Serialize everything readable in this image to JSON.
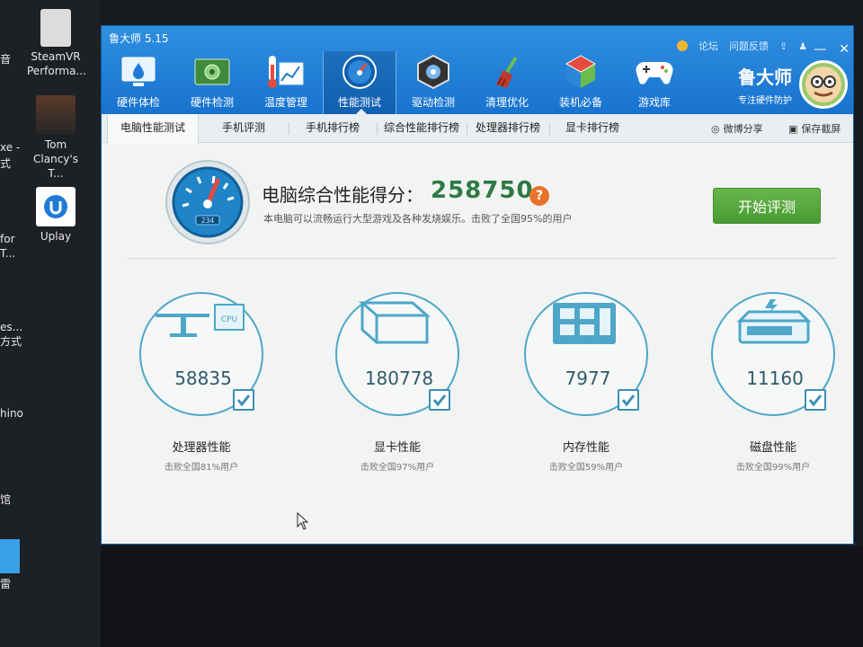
{
  "desktop": {
    "icons": [
      {
        "label": "SteamVR\nPerforma..."
      },
      {
        "label": "Tom\nClancy's T..."
      },
      {
        "label": "Uplay"
      }
    ],
    "edge_texts": [
      "音",
      "xe -",
      "式",
      "for",
      "T...",
      "es...",
      "方式",
      "hino",
      "馆",
      "雷"
    ]
  },
  "window": {
    "title": "鲁大师 5.15",
    "links": {
      "forum": "论坛",
      "feedback": "问题反馈"
    }
  },
  "toolbar": [
    {
      "label": "硬件体检",
      "icon": "hardware-check-icon"
    },
    {
      "label": "硬件检测",
      "icon": "hardware-detect-icon"
    },
    {
      "label": "温度管理",
      "icon": "temperature-icon"
    },
    {
      "label": "性能测试",
      "icon": "performance-gauge-icon",
      "active": true
    },
    {
      "label": "驱动检测",
      "icon": "driver-icon"
    },
    {
      "label": "清理优化",
      "icon": "broom-icon"
    },
    {
      "label": "装机必备",
      "icon": "cube-icon"
    },
    {
      "label": "游戏库",
      "icon": "gamepad-icon"
    }
  ],
  "brand": {
    "name": "鲁大师",
    "slogan": "专注硬件防护"
  },
  "tabs": [
    {
      "label": "电脑性能测试",
      "active": true
    },
    {
      "label": "手机评测"
    },
    {
      "label": "手机排行榜"
    },
    {
      "label": "综合性能排行榜"
    },
    {
      "label": "处理器排行榜"
    },
    {
      "label": "显卡排行榜"
    }
  ],
  "tab_actions": {
    "share": "微博分享",
    "screenshot": "保存截屏"
  },
  "score": {
    "label": "电脑综合性能得分：",
    "value": "258750",
    "description": "本电脑可以流畅运行大型游戏及各种发烧娱乐。击败了全国95%的用户",
    "gauge_readout": "234",
    "start_button": "开始评测"
  },
  "metrics": [
    {
      "name": "处理器性能",
      "value": "58835",
      "beat": "击败全国81%用户",
      "art": "cpu"
    },
    {
      "name": "显卡性能",
      "value": "180778",
      "beat": "击败全国97%用户",
      "art": "gpu"
    },
    {
      "name": "内存性能",
      "value": "7977",
      "beat": "击败全国59%用户",
      "art": "ram"
    },
    {
      "name": "磁盘性能",
      "value": "11160",
      "beat": "击败全国99%用户",
      "art": "disk"
    }
  ],
  "metric_art_label": "CPU",
  "colors": {
    "accent_blue": "#1c7ad3",
    "score_green": "#2e7a44",
    "button_green": "#5aab3f",
    "help_orange": "#e8732c"
  }
}
